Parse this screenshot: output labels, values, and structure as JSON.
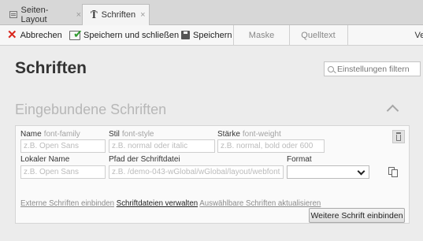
{
  "tabs": [
    {
      "label": "Seiten-Layout",
      "icon": "page-icon",
      "close": "×"
    },
    {
      "label": "Schriften",
      "icon": "typography-icon",
      "close": "×"
    }
  ],
  "toolbar": {
    "cancel_label": "Abbrechen",
    "save_close_label": "Speichern und schließen",
    "save_label": "Speichern",
    "tabs": [
      "Maske",
      "Quelltext",
      "Versi"
    ]
  },
  "page": {
    "title": "Schriften",
    "filter_placeholder": "Einstellungen filtern"
  },
  "section": {
    "title": "Eingebundene Schriften"
  },
  "font_entry": {
    "name": {
      "label": "Name",
      "sub": "font-family",
      "placeholder": "z.B. Open Sans"
    },
    "style": {
      "label": "Stil",
      "sub": "font-style",
      "placeholder": "z.B. normal oder italic"
    },
    "weight": {
      "label": "Stärke",
      "sub": "font-weight",
      "placeholder": "z.B. normal, bold oder 600"
    },
    "local_name": {
      "label": "Lokaler Name",
      "placeholder": "z.B. Open Sans"
    },
    "file_path": {
      "label": "Pfad der Schriftdatei",
      "placeholder": "z.B. /demo-043-wGlobal/wGlobal/layout/webfonts/o"
    },
    "format": {
      "label": "Format",
      "value": ""
    }
  },
  "links": {
    "embed_external": "Externe Schriften einbinden",
    "manage_files": "Schriftdateien verwalten",
    "update_selectable": "Auswählbare Schriften aktualisieren"
  },
  "add_button_label": "Weitere Schrift einbinden",
  "colors": {
    "cancel_icon": "#d9261c",
    "check_icon": "#2e9a2e",
    "section_title": "#b7b7b7",
    "background": "#ececec"
  }
}
